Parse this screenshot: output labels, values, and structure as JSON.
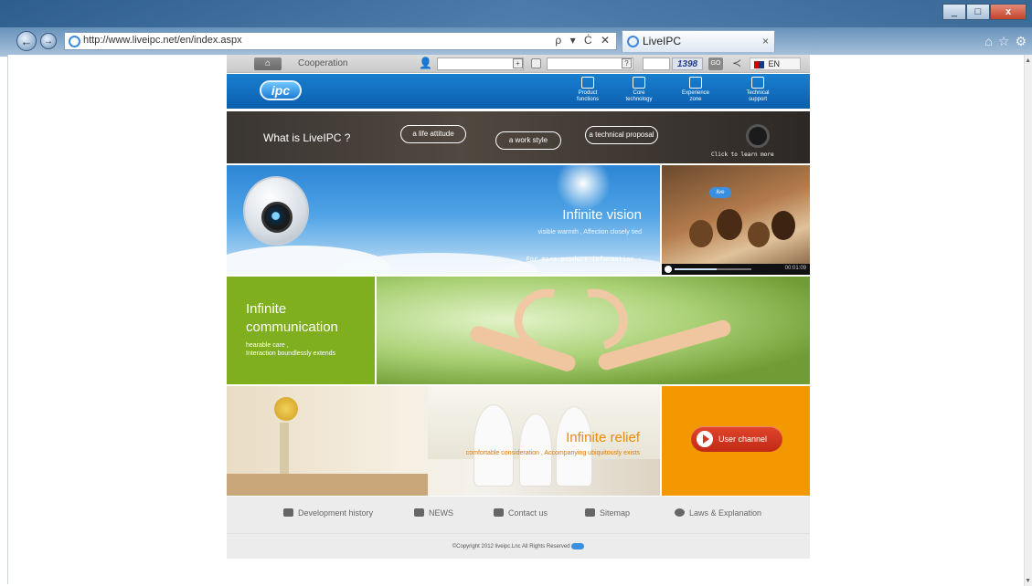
{
  "browser": {
    "url": "http://www.liveipc.net/en/index.aspx",
    "tab_title": "LiveIPC",
    "close_glyph": "×",
    "win_minimize": "_",
    "win_maximize": "□",
    "win_close": "x",
    "addr_tools": "ρ ▾ Ċ ✕"
  },
  "topbar": {
    "home_icon": "home-icon",
    "cooperation": "Cooperation",
    "captcha": "1398",
    "go": "GO",
    "lang": "EN"
  },
  "header": {
    "logo": "ipc",
    "nav": [
      {
        "label1": "Product",
        "label2": "functions"
      },
      {
        "label1": "Core",
        "label2": "technology"
      },
      {
        "label1": "Experience",
        "label2": "zone"
      },
      {
        "label1": "Technical",
        "label2": "support"
      }
    ]
  },
  "strip": {
    "title": "What is LiveIPC ?",
    "pills": [
      "a life attitude",
      "a work style",
      "a technical proposal"
    ],
    "learn": "Click to learn more"
  },
  "vision": {
    "title": "Infinite vision",
    "subtitle": "visible warmth , Affection closely tied",
    "link": "For more product information ›"
  },
  "video": {
    "logo": "live",
    "time": "00:01:09",
    "progress": 0.55
  },
  "communication": {
    "title1": "Infinite",
    "title2": "communication",
    "sub1": "hearable care ,",
    "sub2": "Interaction boundlessly extends"
  },
  "relief": {
    "title": "Infinite relief",
    "subtitle": "comfortable consideration , Accompanying ubiquitously exists"
  },
  "user_channel": {
    "label": "User channel"
  },
  "footer": {
    "links": [
      "Development history",
      "NEWS",
      "Contact us",
      "Sitemap",
      "Laws & Explanation"
    ],
    "copyright": "©Copyright 2012 liveipc.Lnc All Rights Reserved"
  }
}
